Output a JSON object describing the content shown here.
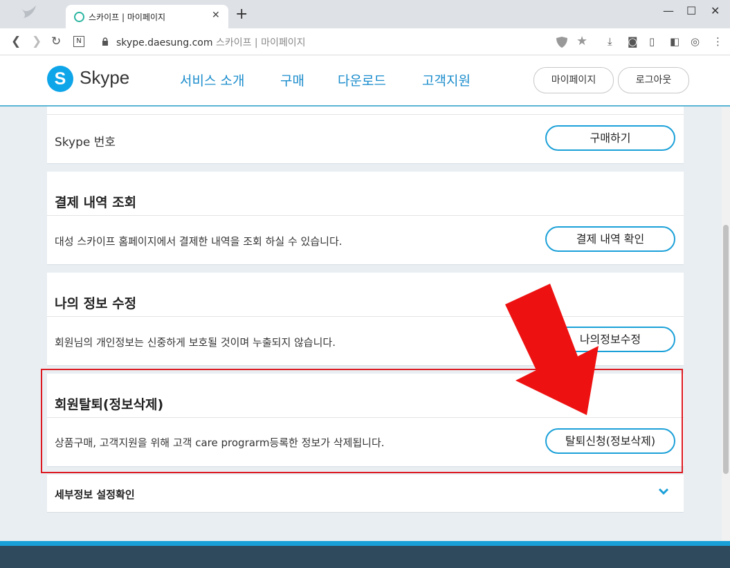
{
  "browser": {
    "tab_title": "스카이프  |  마이페이지",
    "url_domain": "skype.daesung.com",
    "url_suffix": "스카이프  |  마이페이지",
    "new_tab": "+",
    "close_tab": "✕"
  },
  "header": {
    "logo_letter": "S",
    "logo_text": "Skype",
    "nav": [
      "서비스 소개",
      "구매",
      "다운로드",
      "고객지원"
    ],
    "mypage_button": "마이페이지",
    "logout_button": "로그아웃"
  },
  "sections": {
    "skype_number": {
      "label": "Skype 번호",
      "button": "구매하기"
    },
    "payment": {
      "title": "결제 내역 조회",
      "desc": "대성 스카이프 홈페이지에서 결제한 내역을 조회 하실 수 있습니다.",
      "button": "결제 내역 확인"
    },
    "myinfo": {
      "title": "나의 정보 수정",
      "desc": "회원님의 개인정보는 신중하게 보호될 것이며 누출되지 않습니다.",
      "button": "나의정보수정"
    },
    "withdraw": {
      "title": "회원탈퇴(정보삭제)",
      "desc": "상품구매, 고객지원을 위해 고객 care prograrm등록한 정보가 삭제됩니다.",
      "button": "탈퇴신청(정보삭제)"
    },
    "details": {
      "title": "세부정보 설정확인"
    }
  },
  "colors": {
    "accent": "#1aa0d8",
    "highlight": "#dd1a22",
    "arrow": "#ee1111"
  },
  "icons": [
    "back-icon",
    "forward-icon",
    "reload-icon",
    "lock-icon",
    "shield-icon",
    "star-icon",
    "download-icon",
    "camera-icon",
    "reader-icon",
    "sidebar-icon",
    "profile-icon",
    "menu-icon",
    "chevron-down-icon"
  ]
}
